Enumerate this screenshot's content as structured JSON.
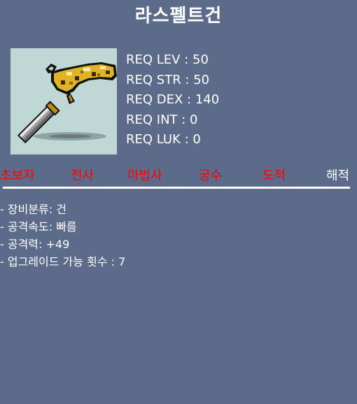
{
  "item": {
    "name": "라스펠트건"
  },
  "requirements": [
    {
      "label": "REQ LEV : 50"
    },
    {
      "label": "REQ STR : 50"
    },
    {
      "label": "REQ DEX : 140"
    },
    {
      "label": "REQ INT : 0"
    },
    {
      "label": "REQ LUK : 0"
    }
  ],
  "jobs": [
    {
      "label": "초보자",
      "color": "#ff0000"
    },
    {
      "label": "전사",
      "color": "#ff0000"
    },
    {
      "label": "마법사",
      "color": "#ff0000"
    },
    {
      "label": "궁수",
      "color": "#ff0000"
    },
    {
      "label": "도적",
      "color": "#ff0000"
    },
    {
      "label": "해적",
      "color": "#ffffff"
    }
  ],
  "details": [
    {
      "text": "- 장비분류: 건"
    },
    {
      "text": "- 공격속도: 빠름"
    },
    {
      "text": "- 공격력: +49"
    },
    {
      "text": "- 업그레이드 가능 횟수 : 7"
    }
  ],
  "colors": {
    "background": "#5d6b8b",
    "icon_background": "#bfd8d6",
    "restricted_job": "#ff0000",
    "allowed_job": "#ffffff"
  },
  "icon": "gun-icon"
}
